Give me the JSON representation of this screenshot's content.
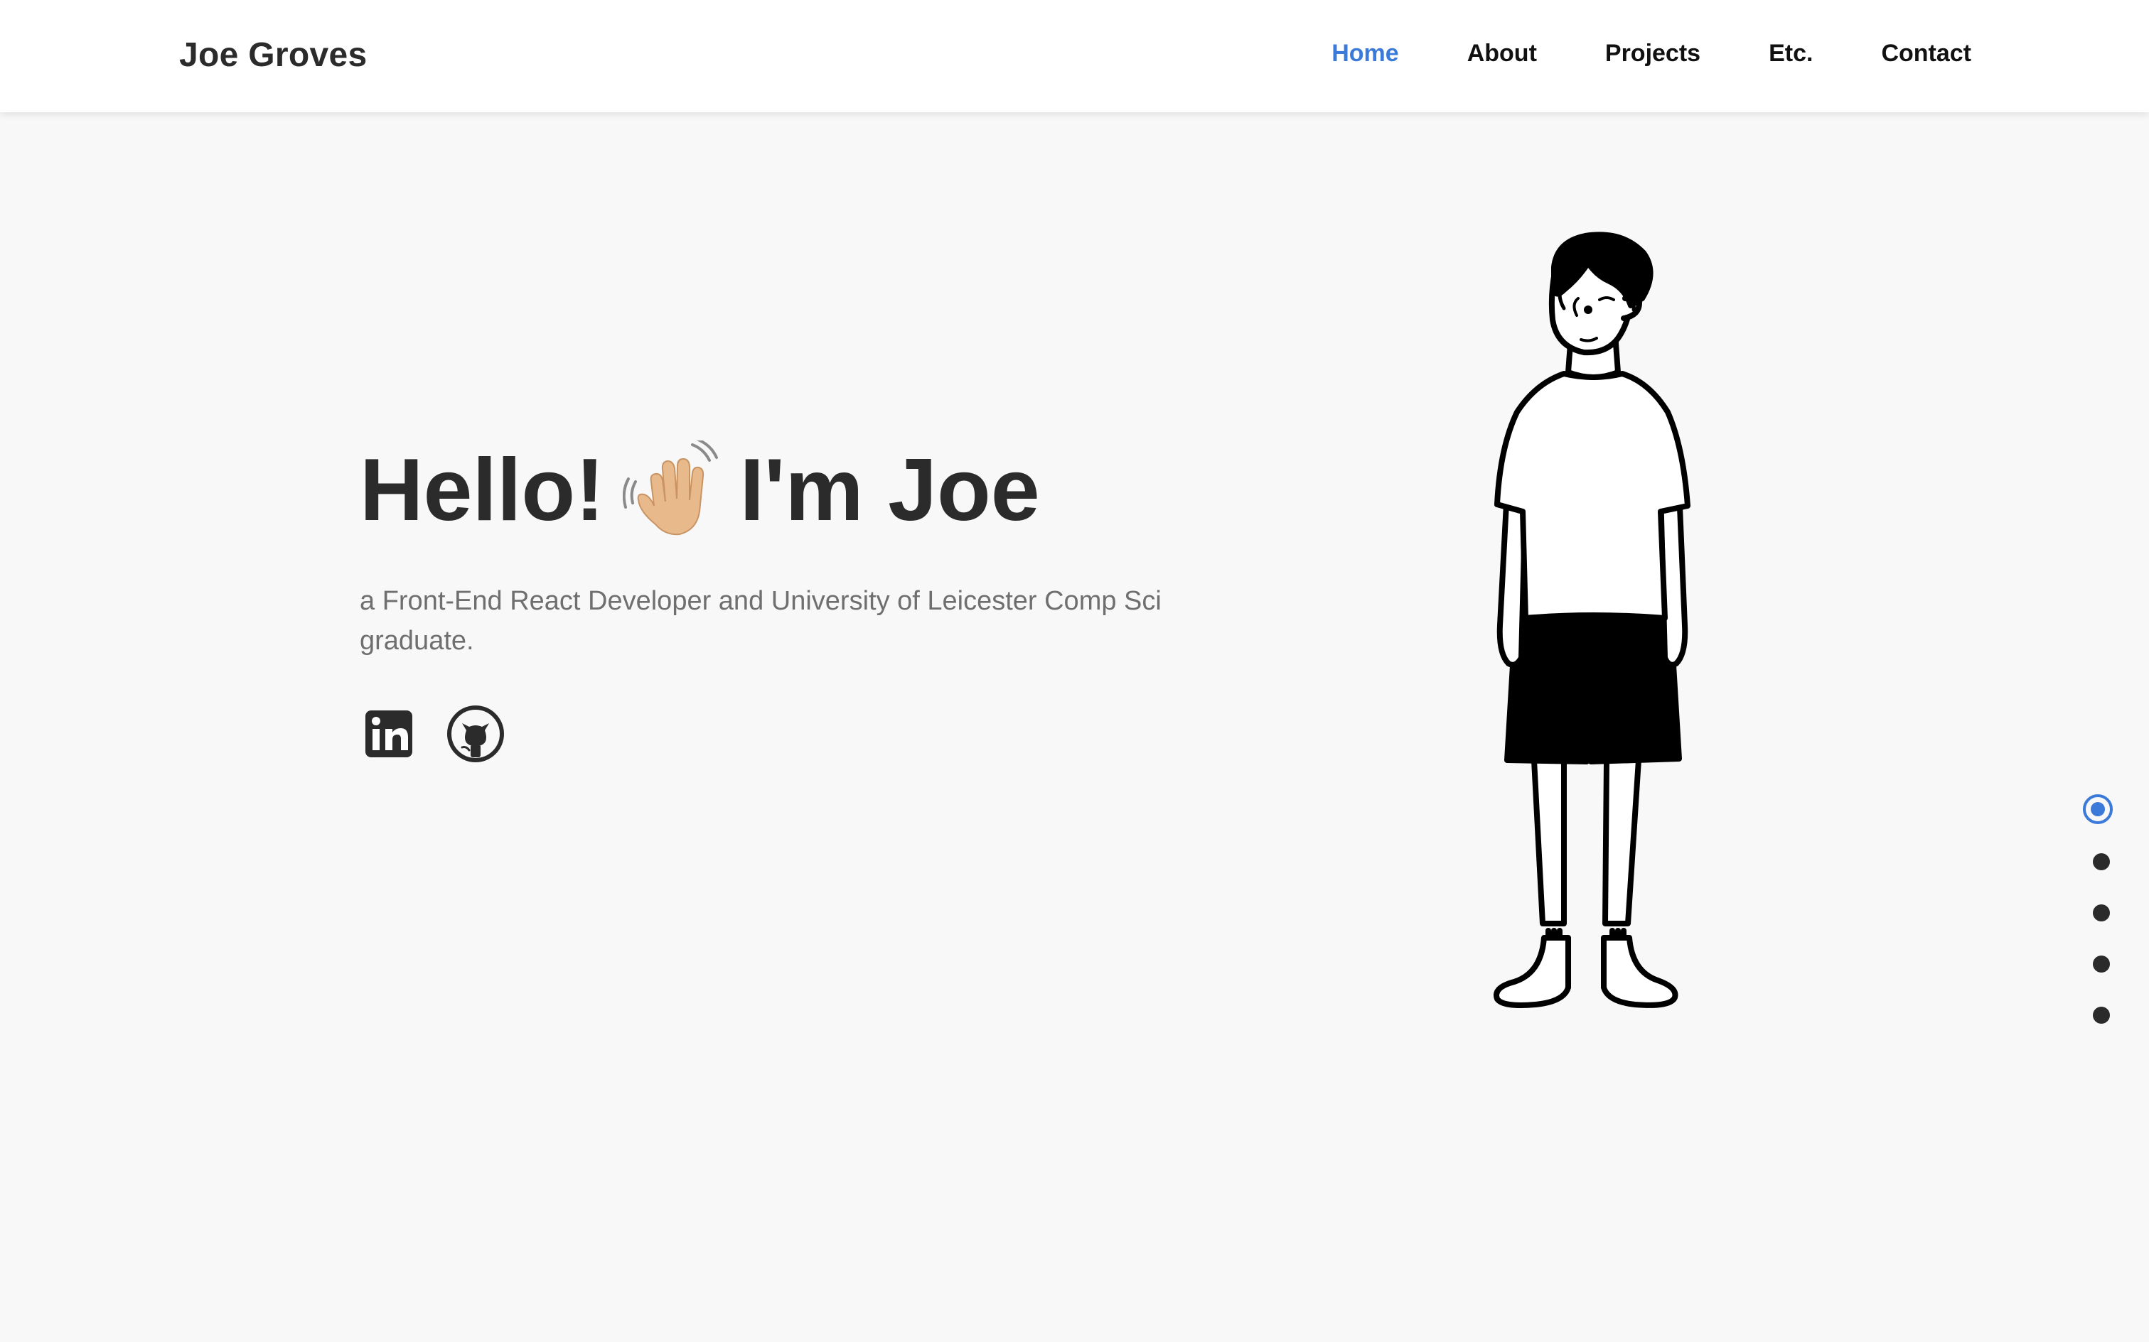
{
  "header": {
    "brand": "Joe Groves",
    "nav": [
      {
        "label": "Home",
        "active": true
      },
      {
        "label": "About",
        "active": false
      },
      {
        "label": "Projects",
        "active": false
      },
      {
        "label": "Etc.",
        "active": false
      },
      {
        "label": "Contact",
        "active": false
      }
    ]
  },
  "hero": {
    "greeting": "Hello!",
    "wave_icon": "waving-hand-emoji",
    "name": "I'm Joe",
    "subtitle": "a Front-End React Developer and University of Leicester Comp Sci graduate.",
    "socials": [
      {
        "name": "linkedin-icon"
      },
      {
        "name": "github-icon"
      }
    ]
  },
  "illustration": {
    "name": "cartoon-person-illustration"
  },
  "section_dots": {
    "count": 5,
    "active_index": 0
  },
  "colors": {
    "accent": "#3b7ad8",
    "text_dark": "#2b2b2b",
    "text_muted": "#6f6f6f",
    "background": "#f8f8f8",
    "header_bg": "#ffffff"
  }
}
